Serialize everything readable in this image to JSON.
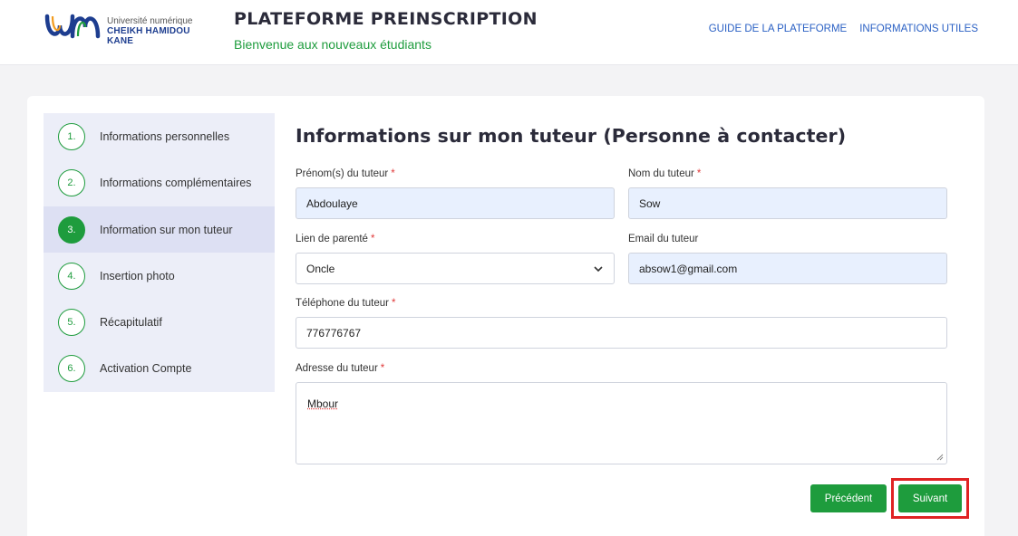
{
  "header": {
    "logo_line1": "Université numérique",
    "logo_line2": "CHEIKH HAMIDOU KANE",
    "title": "PLATEFORME PREINSCRIPTION",
    "subtitle": "Bienvenue aux nouveaux étudiants",
    "nav": [
      "GUIDE DE LA PLATEFORME",
      "INFORMATIONS UTILES"
    ]
  },
  "steps": [
    {
      "num": "1.",
      "label": "Informations personnelles",
      "active": false
    },
    {
      "num": "2.",
      "label": "Informations complémentaires",
      "active": false
    },
    {
      "num": "3.",
      "label": "Information sur mon tuteur",
      "active": true
    },
    {
      "num": "4.",
      "label": "Insertion photo",
      "active": false
    },
    {
      "num": "5.",
      "label": "Récapitulatif",
      "active": false
    },
    {
      "num": "6.",
      "label": "Activation Compte",
      "active": false
    }
  ],
  "form": {
    "title": "Informations sur mon tuteur (Personne à contacter)",
    "first_name": {
      "label": "Prénom(s) du tuteur",
      "required_mark": "*",
      "value": "Abdoulaye"
    },
    "last_name": {
      "label": "Nom du tuteur",
      "required_mark": "*",
      "value": "Sow"
    },
    "relation": {
      "label": "Lien de parenté",
      "required_mark": "*",
      "value": "Oncle"
    },
    "email": {
      "label": "Email du tuteur",
      "value": "absow1@gmail.com"
    },
    "phone": {
      "label": "Téléphone du tuteur",
      "required_mark": "*",
      "value": "776776767"
    },
    "address": {
      "label": "Adresse du tuteur",
      "required_mark": "*",
      "value": "Mbour"
    }
  },
  "buttons": {
    "previous": "Précédent",
    "next": "Suivant"
  },
  "colors": {
    "accent_green": "#1e9c3d",
    "link_blue": "#2a60c4",
    "highlight_red": "#e02323",
    "autofill_blue": "#e8f0fe"
  }
}
